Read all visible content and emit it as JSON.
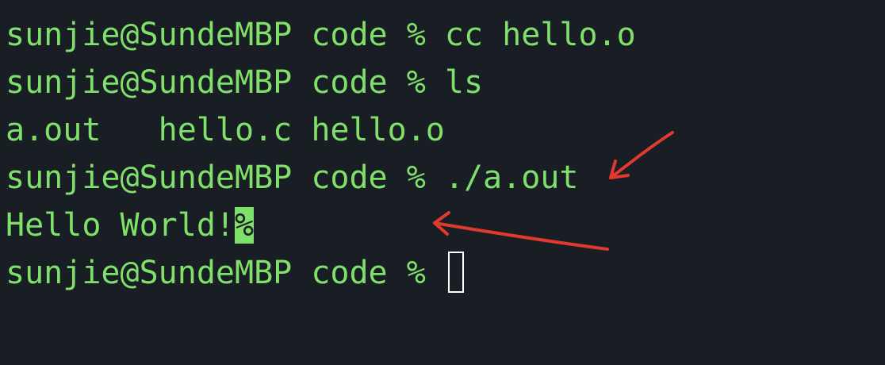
{
  "terminal": {
    "lines": [
      {
        "text": "sunjie@SundeMBP code % cc hello.o"
      },
      {
        "text": "sunjie@SundeMBP code % ls"
      },
      {
        "text": "a.out   hello.c hello.o"
      },
      {
        "text": "sunjie@SundeMBP code % ./a.out"
      },
      {
        "text": "Hello World!",
        "marker": "%"
      },
      {
        "text": "sunjie@SundeMBP code % "
      }
    ],
    "colors": {
      "background": "#191e25",
      "foreground": "#7fe06a",
      "annotation_arrow": "#e03a2e",
      "cursor": "#ffffff"
    }
  }
}
